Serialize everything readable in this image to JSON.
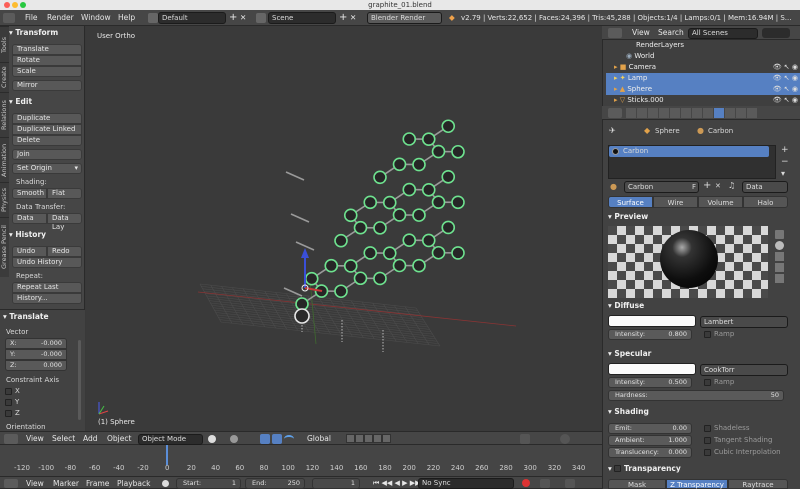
{
  "window": {
    "title": "graphite_01.blend"
  },
  "info_header": {
    "menus": [
      "File",
      "Render",
      "Window",
      "Help"
    ],
    "layout": "Default",
    "scene": "Scene",
    "engine": "Blender Render",
    "stats": "v2.79 | Verts:22,652 | Faces:24,396 | Tris:45,288 | Objects:1/4 | Lamps:0/1 | Mem:16.94M | S..."
  },
  "toolshelf": {
    "tabs": [
      "Tools",
      "Create",
      "Relations",
      "Animation",
      "Physics",
      "Grease Pencil"
    ],
    "transform": {
      "title": "Transform",
      "translate": "Translate",
      "rotate": "Rotate",
      "scale": "Scale",
      "mirror": "Mirror"
    },
    "edit": {
      "title": "Edit",
      "duplicate": "Duplicate",
      "duplicate_linked": "Duplicate Linked",
      "delete": "Delete",
      "join": "Join",
      "set_origin": "Set Origin",
      "shading": "Shading:",
      "smooth": "Smooth",
      "flat": "Flat",
      "data_transfer": "Data Transfer:",
      "data": "Data",
      "data_lay": "Data Lay"
    },
    "history": {
      "title": "History",
      "undo": "Undo",
      "redo": "Redo",
      "undo_history": "Undo History",
      "repeat": "Repeat:",
      "repeat_last": "Repeat Last",
      "history": "History..."
    }
  },
  "operator": {
    "title": "Translate",
    "vector_label": "Vector",
    "x_label": "X:",
    "x": "-0.000",
    "y_label": "Y:",
    "y": "-0.000",
    "z_label": "Z:",
    "z": "0.000",
    "constraint_label": "Constraint Axis",
    "cx": "X",
    "cy": "Y",
    "cz": "Z",
    "orientation": "Orientation"
  },
  "viewport": {
    "view_name": "User Ortho",
    "active_object": "(1) Sphere"
  },
  "viewport_header": {
    "view": "View",
    "select": "Select",
    "add": "Add",
    "object": "Object",
    "mode": "Object Mode",
    "orientation": "Global"
  },
  "timeline": {
    "ticks": [
      "-120",
      "-100",
      "-80",
      "-60",
      "-40",
      "-20",
      "0",
      "20",
      "40",
      "60",
      "80",
      "100",
      "120",
      "140",
      "160",
      "180",
      "200",
      "220",
      "240",
      "260",
      "280",
      "300",
      "320",
      "340"
    ],
    "current_frame": 1,
    "view": "View",
    "marker": "Marker",
    "frame": "Frame",
    "playback": "Playback",
    "start_label": "Start:",
    "start": "1",
    "end_label": "End:",
    "end": "250",
    "frame_value": "1",
    "sync": "No Sync"
  },
  "outliner": {
    "view": "View",
    "search": "Search",
    "filter": "All Scenes",
    "rows": [
      {
        "label": "RenderLayers",
        "selected": false
      },
      {
        "label": "World",
        "selected": false
      },
      {
        "label": "Camera",
        "selected": false
      },
      {
        "label": "Lamp",
        "selected": true
      },
      {
        "label": "Sphere",
        "selected": true
      },
      {
        "label": "Sticks.000",
        "selected": false
      }
    ]
  },
  "properties": {
    "breadcrumb_object": "Sphere",
    "breadcrumb_material": "Carbon",
    "slot_name": "Carbon",
    "material_name": "Carbon",
    "f_flag": "F",
    "data_select": "Data",
    "tabs": [
      "Surface",
      "Wire",
      "Volume",
      "Halo"
    ],
    "preview_title": "Preview",
    "diffuse": {
      "title": "Diffuse",
      "shader": "Lambert",
      "intensity_label": "Intensity:",
      "intensity": "0.800",
      "ramp": "Ramp"
    },
    "specular": {
      "title": "Specular",
      "shader": "CookTorr",
      "intensity_label": "Intensity:",
      "intensity": "0.500",
      "ramp": "Ramp",
      "hardness_label": "Hardness:",
      "hardness": "50"
    },
    "shading": {
      "title": "Shading",
      "emit_label": "Emit:",
      "emit": "0.00",
      "ambient_label": "Ambient:",
      "ambient": "1.000",
      "translucency_label": "Translucency:",
      "translucency": "0.000",
      "shadeless": "Shadeless",
      "tangent": "Tangent Shading",
      "cubic": "Cubic Interpolation"
    },
    "transparency": {
      "title": "Transparency",
      "mask": "Mask",
      "ztrans": "Z Transparency",
      "raytrace": "Raytrace"
    }
  },
  "colors": {
    "selected_row": "#5680c2",
    "atom_outline": "#6ee28f",
    "active_tab": "#5680c2"
  }
}
